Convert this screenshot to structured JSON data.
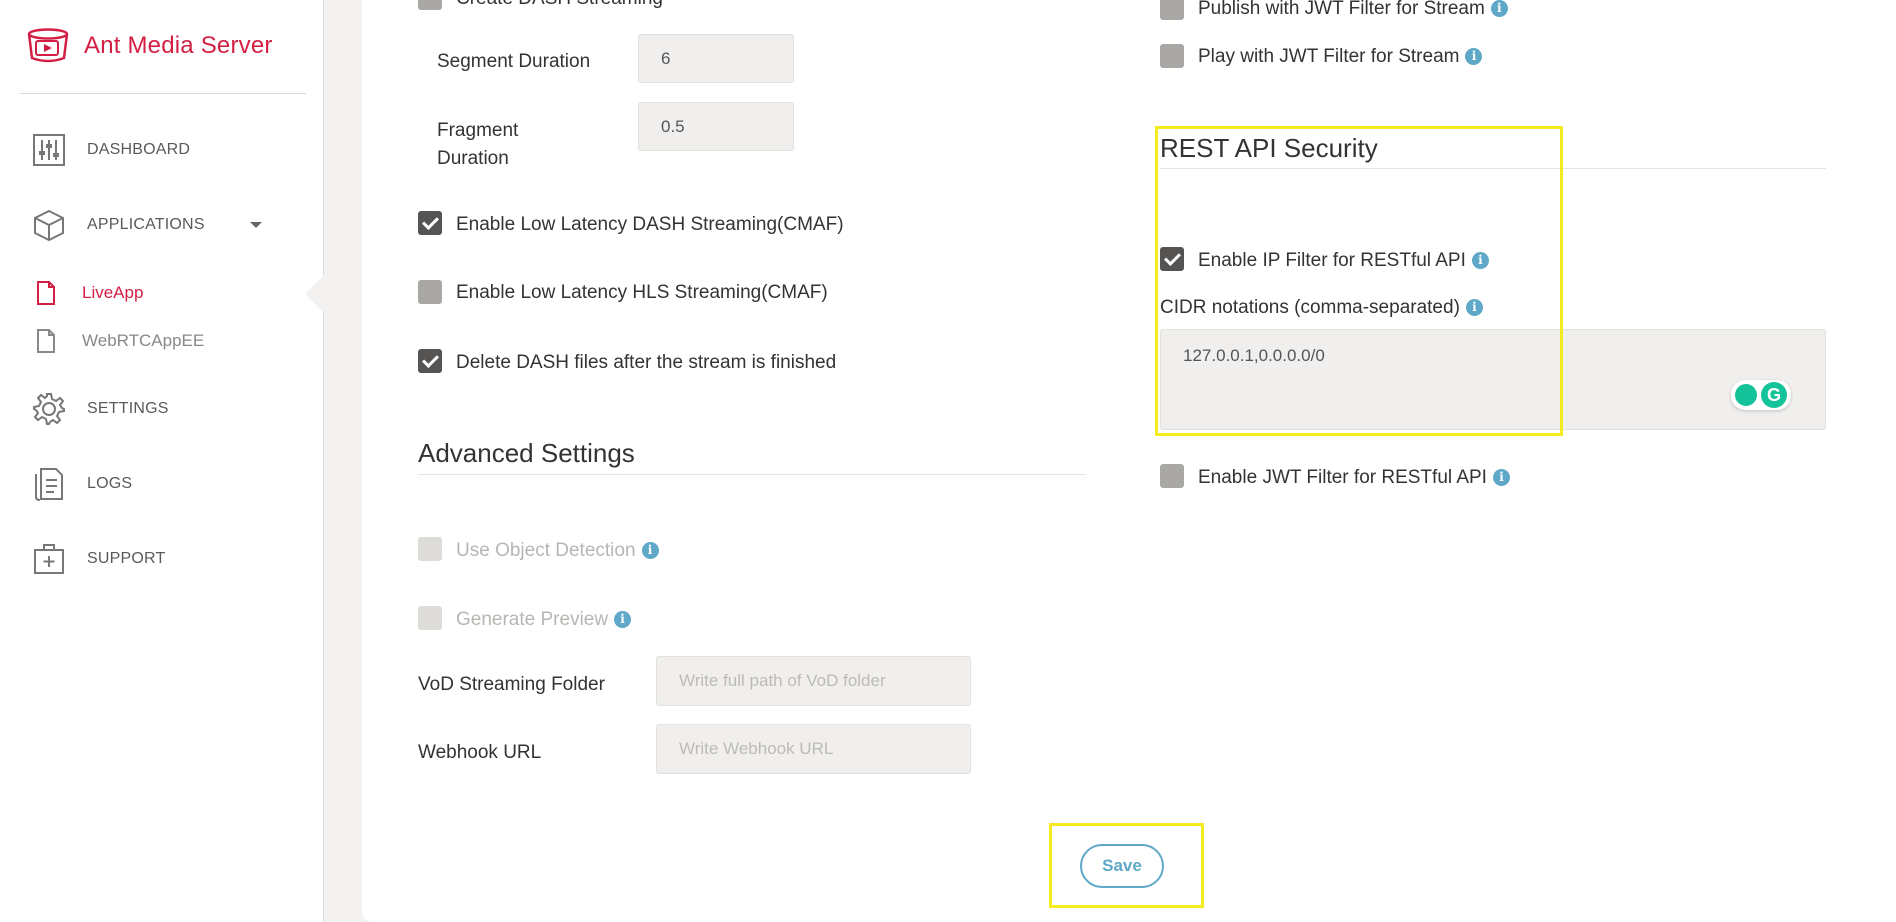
{
  "brand": {
    "name": "Ant Media Server",
    "color": "#d31f43"
  },
  "sidebar": {
    "items": [
      {
        "label": "DASHBOARD",
        "icon": "sliders-icon"
      },
      {
        "label": "APPLICATIONS",
        "icon": "box-icon"
      },
      {
        "label": "SETTINGS",
        "icon": "gear-icon"
      },
      {
        "label": "LOGS",
        "icon": "logs-icon"
      },
      {
        "label": "SUPPORT",
        "icon": "first-aid-icon"
      }
    ],
    "apps": [
      {
        "label": "LiveApp",
        "active": true
      },
      {
        "label": "WebRTCAppEE",
        "active": false
      }
    ]
  },
  "left": {
    "create_dash": "Create DASH Streaming",
    "segment_duration": {
      "label": "Segment Duration",
      "value": "6"
    },
    "fragment_duration": {
      "label_line1": "Fragment",
      "label_line2": "Duration",
      "value": "0.5"
    },
    "ll_dash": {
      "label": "Enable Low Latency DASH Streaming(CMAF)",
      "checked": true
    },
    "ll_hls": {
      "label": "Enable Low Latency HLS Streaming(CMAF)",
      "checked": false
    },
    "delete_dash": {
      "label": "Delete DASH files after the stream is finished",
      "checked": true
    },
    "advanced_title": "Advanced Settings",
    "object_detection": {
      "label": "Use Object Detection",
      "checked": false,
      "disabled": true
    },
    "generate_preview": {
      "label": "Generate Preview",
      "checked": false,
      "disabled": true
    },
    "vod_folder": {
      "label": "VoD Streaming Folder",
      "placeholder": "Write full path of VoD folder"
    },
    "webhook": {
      "label": "Webhook URL",
      "placeholder": "Write Webhook URL"
    }
  },
  "right": {
    "publish_jwt": {
      "label": "Publish with JWT Filter for Stream",
      "checked": false
    },
    "play_jwt": {
      "label": "Play with JWT Filter for Stream",
      "checked": false
    },
    "rest_title": "REST API Security",
    "ip_filter": {
      "label": "Enable IP Filter for RESTful API",
      "checked": true
    },
    "cidr": {
      "label": "CIDR notations (comma-separated)",
      "value": "127.0.0.1,0.0.0.0/0"
    },
    "jwt_rest": {
      "label": "Enable JWT Filter for RESTful API",
      "checked": false
    }
  },
  "save_label": "Save",
  "colors": {
    "accent": "#d31f43",
    "info": "#5fa8c7",
    "highlight": "#f4ea1e"
  }
}
